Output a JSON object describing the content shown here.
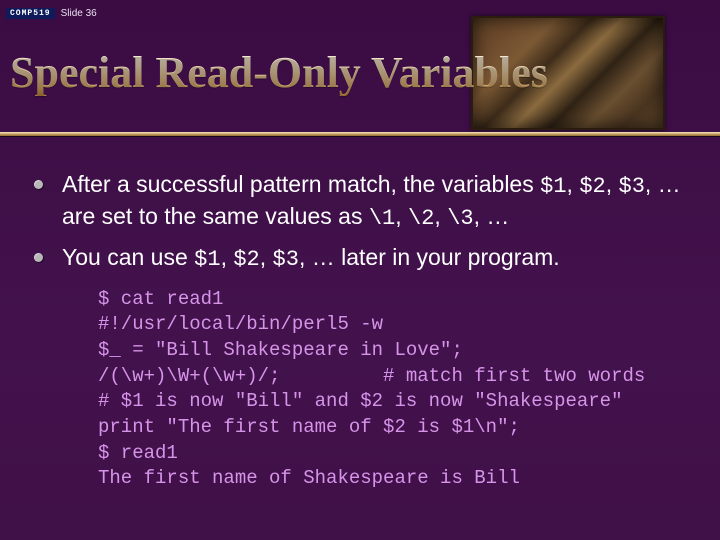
{
  "meta": {
    "logo_text": "COMP519",
    "slide_label": "Slide 36"
  },
  "title": "Special Read-Only Variables",
  "bullets": [
    {
      "pre": "After a successful pattern match, the variables ",
      "c1": "$1",
      "m1": ", ",
      "c2": "$2",
      "m2": ", ",
      "c3": "$3",
      "m3": ", … are set to the same values as ",
      "c4": "\\1",
      "m4": ", ",
      "c5": "\\2",
      "m5": ", ",
      "c6": "\\3",
      "post": ", …"
    },
    {
      "pre": "You can use ",
      "c1": "$1",
      "m1": ", ",
      "c2": "$2",
      "m2": ", ",
      "c3": "$3",
      "post": ", … later in your program."
    }
  ],
  "code": "$ cat read1\n#!/usr/local/bin/perl5 -w\n$_ = \"Bill Shakespeare in Love\";\n/(\\w+)\\W+(\\w+)/;         # match first two words\n# $1 is now \"Bill\" and $2 is now \"Shakespeare\"\nprint \"The first name of $2 is $1\\n\";\n$ read1\nThe first name of Shakespeare is Bill"
}
